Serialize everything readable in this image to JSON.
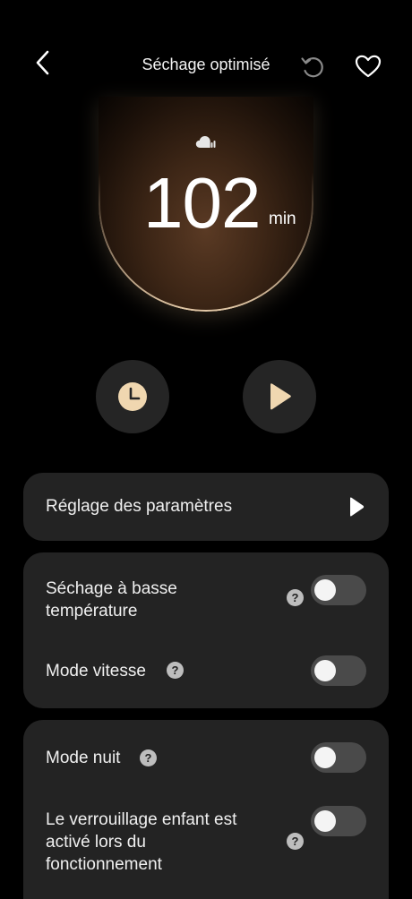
{
  "header": {
    "title": "Séchage optimisé",
    "back_icon": "chevron-left-icon",
    "undo_icon": "undo-icon",
    "favorite_icon": "heart-icon"
  },
  "hero": {
    "icon": "cloud-dry-icon",
    "time_value": "102",
    "time_unit": "min",
    "accent_color": "#f0d7b0"
  },
  "actions": {
    "timer_icon": "clock-icon",
    "play_icon": "play-icon"
  },
  "settings_card": {
    "label": "Réglage des paramètres",
    "chevron_icon": "play-triangle-icon"
  },
  "options_group_1": [
    {
      "label": "Séchage à basse température",
      "help": "?",
      "enabled": false
    },
    {
      "label": "Mode vitesse",
      "help": "?",
      "enabled": false
    }
  ],
  "options_group_2": [
    {
      "label": "Mode nuit",
      "help": "?",
      "enabled": false
    },
    {
      "label": "Le verrouillage enfant est activé lors du fonctionnement",
      "help": "?",
      "enabled": false
    }
  ]
}
